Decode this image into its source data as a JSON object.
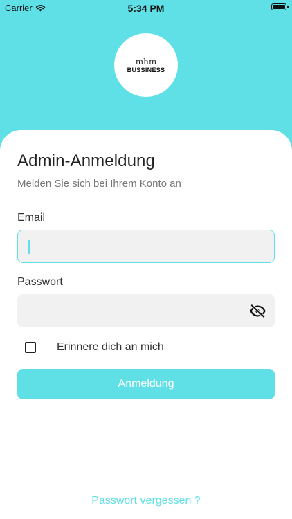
{
  "status_bar": {
    "carrier": "Carrier",
    "time": "5:34 PM",
    "battery_level": 1.0
  },
  "logo": {
    "glyph": "mhm",
    "name": "BUSSINESS"
  },
  "login": {
    "title": "Admin-Anmeldung",
    "subtitle": "Melden Sie sich bei Ihrem Konto an",
    "email_label": "Email",
    "email_value": "",
    "password_label": "Passwort",
    "password_value": "",
    "remember_label": "Erinnere dich an mich",
    "remember_checked": false,
    "submit_label": "Anmeldung",
    "forgot_label": "Passwort vergessen ?"
  },
  "colors": {
    "accent": "#5fe0e6",
    "input_bg": "#f1f1f1",
    "text": "#222222",
    "muted": "#777777"
  },
  "icons": {
    "wifi": "wifi-icon",
    "battery": "battery-icon",
    "password_visibility": "eye-off-icon"
  }
}
